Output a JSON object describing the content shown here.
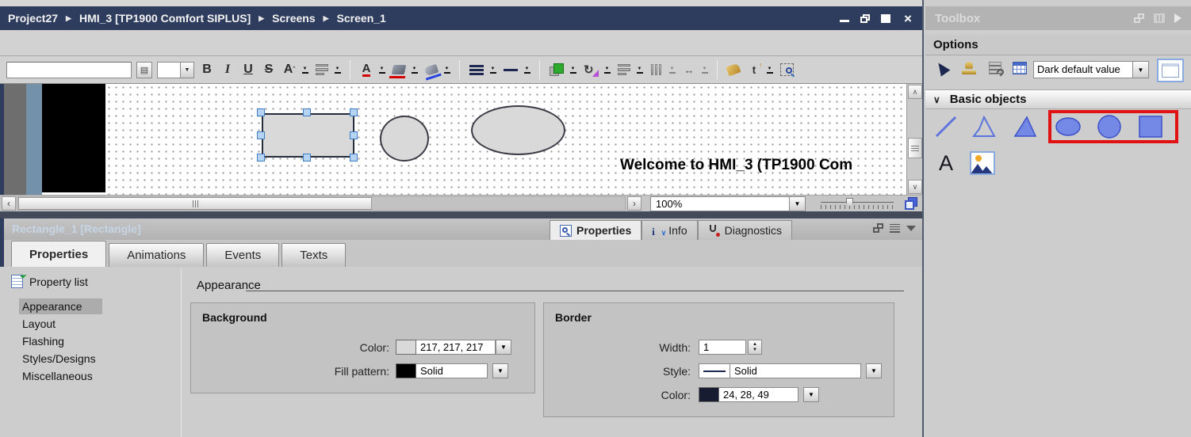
{
  "titlebar": {
    "items": [
      "Project27",
      "HMI_3 [TP1900 Comfort SIPLUS]",
      "Screens",
      "Screen_1"
    ],
    "sep": "▶"
  },
  "glyphs": {
    "dropdown": "▼",
    "spin_up": "▲",
    "spin_down": "▼",
    "list_button": "▤",
    "scroll_left": "‹",
    "scroll_right": "›",
    "scroll_up": "∧",
    "scroll_down": "∨",
    "chevron_down": "∨",
    "caret": "ˆ",
    "resize_arrow": "↔",
    "rotate_arrow": "↻",
    "order_letter": "t",
    "order_up": "↑",
    "info_letter": "i"
  },
  "format_toolbar": {
    "style_field_value": "",
    "font_size_value": "",
    "bold": "B",
    "italic": "I",
    "underline": "U",
    "strikethrough": "S",
    "font_size_label": "A"
  },
  "canvas": {
    "welcome_text": "Welcome to HMI_3 (TP1900 Com",
    "shapes": [
      {
        "type": "rectangle",
        "selected": true
      },
      {
        "type": "circle"
      },
      {
        "type": "ellipse"
      }
    ]
  },
  "statusbar": {
    "zoom_value": "100%"
  },
  "inspector": {
    "title": "Rectangle_1 [Rectangle]",
    "tabs": [
      "Properties",
      "Animations",
      "Events",
      "Texts"
    ],
    "active_tab": "Properties",
    "side_tabs": [
      "Properties",
      "Info",
      "Diagnostics"
    ],
    "property_list": {
      "header": "Property list",
      "items": [
        "Appearance",
        "Layout",
        "Flashing",
        "Styles/Designs",
        "Miscellaneous"
      ],
      "selected": "Appearance"
    },
    "section_title": "Appearance",
    "background": {
      "title": "Background",
      "color_label": "Color:",
      "color_value": "217, 217, 217",
      "color_swatch": "#d9d9d9",
      "fill_label": "Fill pattern:",
      "fill_value": "Solid",
      "fill_swatch": "#000000"
    },
    "border": {
      "title": "Border",
      "width_label": "Width:",
      "width_value": "1",
      "style_label": "Style:",
      "style_value": "Solid",
      "color_label": "Color:",
      "color_value": "24, 28, 49",
      "color_swatch": "#181c31"
    }
  },
  "toolbox": {
    "title": "Toolbox",
    "options_header": "Options",
    "style_dropdown_value": "Dark default value",
    "basic_objects_header": "Basic objects",
    "text_tool_label": "A",
    "objects": [
      "line",
      "polyline",
      "polygon",
      "ellipse",
      "circle",
      "rectangle",
      "text-field",
      "graphic-view"
    ],
    "highlighted_objects": [
      "ellipse",
      "circle",
      "rectangle"
    ]
  },
  "colors": {
    "titlebar": "#2e3c5e",
    "highlight_red": "#e01212",
    "object_blue": "#7488e6",
    "shape_fill": "#d9d9d9",
    "shape_border": "#181c31"
  }
}
